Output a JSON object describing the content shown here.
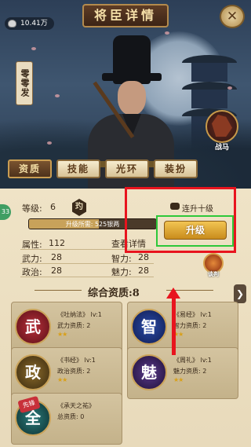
{
  "header": {
    "title": "将臣详情",
    "silver_amount": "10.41万",
    "close_label": "✕"
  },
  "hero": {
    "name": "零零发",
    "warhorse_label": "战马"
  },
  "tabs": [
    {
      "label": "资质",
      "active": true
    },
    {
      "label": "技能",
      "active": false
    },
    {
      "label": "光环",
      "active": false
    },
    {
      "label": "装扮",
      "active": false
    }
  ],
  "level": {
    "label": "等级:",
    "value": "6",
    "rank_glyph": "玓",
    "ten_levels_label": "连升十级",
    "progress_text": "升级所需: 525银两",
    "progress_fraction": 0.55,
    "upgrade_label": "升级",
    "left_badge": "33"
  },
  "stats": {
    "attr_label": "属性:",
    "attr_value": "112",
    "detail_label": "查看详情",
    "wuli_label": "武力:",
    "wuli_value": "28",
    "zhili_label": "智力:",
    "zhili_value": "28",
    "zhengzhi_label": "政治:",
    "zhengzhi_value": "28",
    "meili_label": "魅力:",
    "meili_value": "28",
    "sash_label": "谈判"
  },
  "aptitude": {
    "title": "综合资质:8"
  },
  "skills": [
    {
      "emblem": "武",
      "name": "《吐纳法》 lv:1",
      "sub": "武力资质: 2",
      "stars": "★★"
    },
    {
      "emblem": "智",
      "name": "《易经》 lv:1",
      "sub": "智力资质: 2",
      "stars": "★★"
    },
    {
      "emblem": "政",
      "name": "《书经》 lv:1",
      "sub": "政治资质: 2",
      "stars": "★★"
    },
    {
      "emblem": "魅",
      "name": "《周礼》 lv:1",
      "sub": "魅力资质: 2",
      "stars": "★★"
    },
    {
      "emblem": "全",
      "name": "《承天之祐》",
      "sub": "总资质: 0",
      "stars": "",
      "badge": "先锋"
    }
  ],
  "colors": {
    "annotation_red": "#e8141e",
    "annotation_green": "#2ec83a",
    "upgrade_gold": "#f2c553"
  }
}
